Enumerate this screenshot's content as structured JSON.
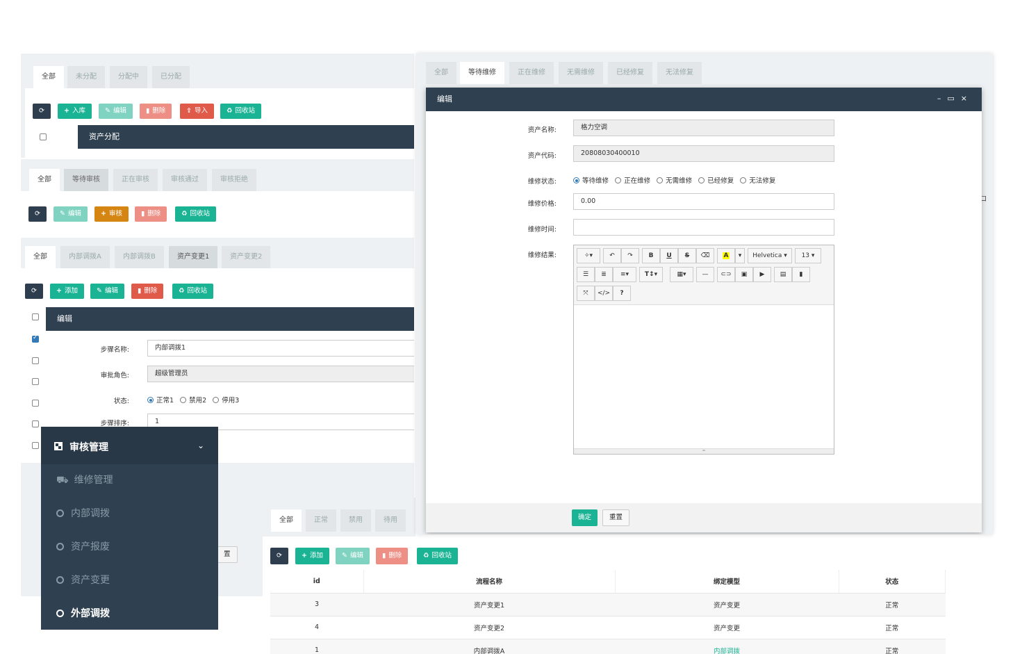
{
  "panel1": {
    "tabs": [
      "全部",
      "未分配",
      "分配中",
      "已分配"
    ],
    "buttons": {
      "refresh": "",
      "stock_in": "入库",
      "edit": "编辑",
      "delete": "删除",
      "import": "导入",
      "recycle": "回收站"
    },
    "modal_title": "资产分配"
  },
  "panel2": {
    "tabs": [
      "全部",
      "等待审核",
      "正在审核",
      "审核通过",
      "审核拒绝"
    ],
    "buttons": {
      "edit": "编辑",
      "audit": "审核",
      "delete": "删除",
      "recycle": "回收站"
    }
  },
  "panel3": {
    "tabs": [
      "全部",
      "内部调拨A",
      "内部调拨B",
      "资产变更1",
      "资产变更2"
    ],
    "buttons": {
      "add": "添加",
      "edit": "编辑",
      "delete": "删除",
      "recycle": "回收站"
    },
    "modal": {
      "title": "编辑",
      "step_name_label": "步骤名称:",
      "step_name_value": "内部调拨1",
      "role_label": "审批角色:",
      "role_value": "超级管理员",
      "status_label": "状态:",
      "status_options": [
        "正常1",
        "禁用2",
        "停用3"
      ],
      "order_label": "步骤排序:",
      "order_value": "1"
    },
    "partial_button": "置"
  },
  "sidebar": {
    "header": "审核管理",
    "items": [
      "维修管理",
      "内部调拨",
      "资产报废",
      "资产变更",
      "外部调拨"
    ]
  },
  "panel4": {
    "tabs": [
      "全部",
      "正常",
      "禁用",
      "待用"
    ],
    "buttons": {
      "add": "添加",
      "edit": "编辑",
      "delete": "删除",
      "recycle": "回收站"
    },
    "table": {
      "headers": [
        "id",
        "流程名称",
        "绑定模型",
        "状态"
      ],
      "rows": [
        [
          "3",
          "资产变更1",
          "资产变更",
          "正常"
        ],
        [
          "4",
          "资产变更2",
          "资产变更",
          "正常"
        ],
        [
          "1",
          "内部调拨A",
          "内部调拨",
          "正常"
        ]
      ]
    }
  },
  "repair": {
    "tabs": [
      "全部",
      "等待维修",
      "正在维修",
      "无需维修",
      "已经修复",
      "无法修复"
    ],
    "modal": {
      "title": "编辑",
      "asset_name_label": "资产名称:",
      "asset_name_value": "格力空调",
      "asset_code_label": "资产代码:",
      "asset_code_value": "20808030400010",
      "status_label": "维修状态:",
      "status_options": [
        "等待维修",
        "正在维修",
        "无需维修",
        "已经修复",
        "无法修复"
      ],
      "price_label": "维修价格:",
      "price_value": "0.00",
      "time_label": "维修时间:",
      "time_value": "",
      "result_label": "维修结果:",
      "editor": {
        "font_name": "Helvetica",
        "font_size": "13"
      },
      "ok": "确定",
      "reset": "重置"
    },
    "partial_right": "口"
  }
}
